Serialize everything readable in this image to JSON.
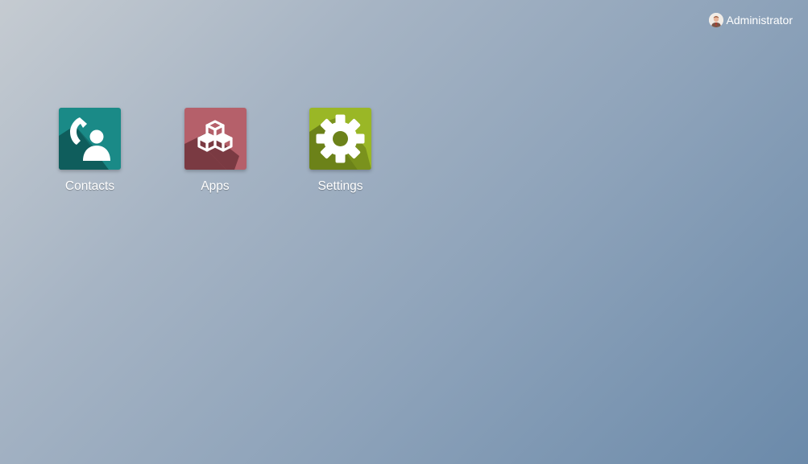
{
  "header": {
    "user_name": "Administrator",
    "avatar_icon": "user-avatar-icon"
  },
  "apps": [
    {
      "label": "Contacts",
      "icon": "contacts-icon",
      "color": "#1a8a87",
      "shadow": "#0f5e5c"
    },
    {
      "label": "Apps",
      "icon": "apps-cubes-icon",
      "color": "#b5606a",
      "shadow": "#7a3a42"
    },
    {
      "label": "Settings",
      "icon": "gear-icon",
      "color": "#9ab726",
      "shadow": "#6c8219"
    }
  ],
  "colors": {
    "background_start": "#c5cbd1",
    "background_end": "#6b8aaa"
  }
}
